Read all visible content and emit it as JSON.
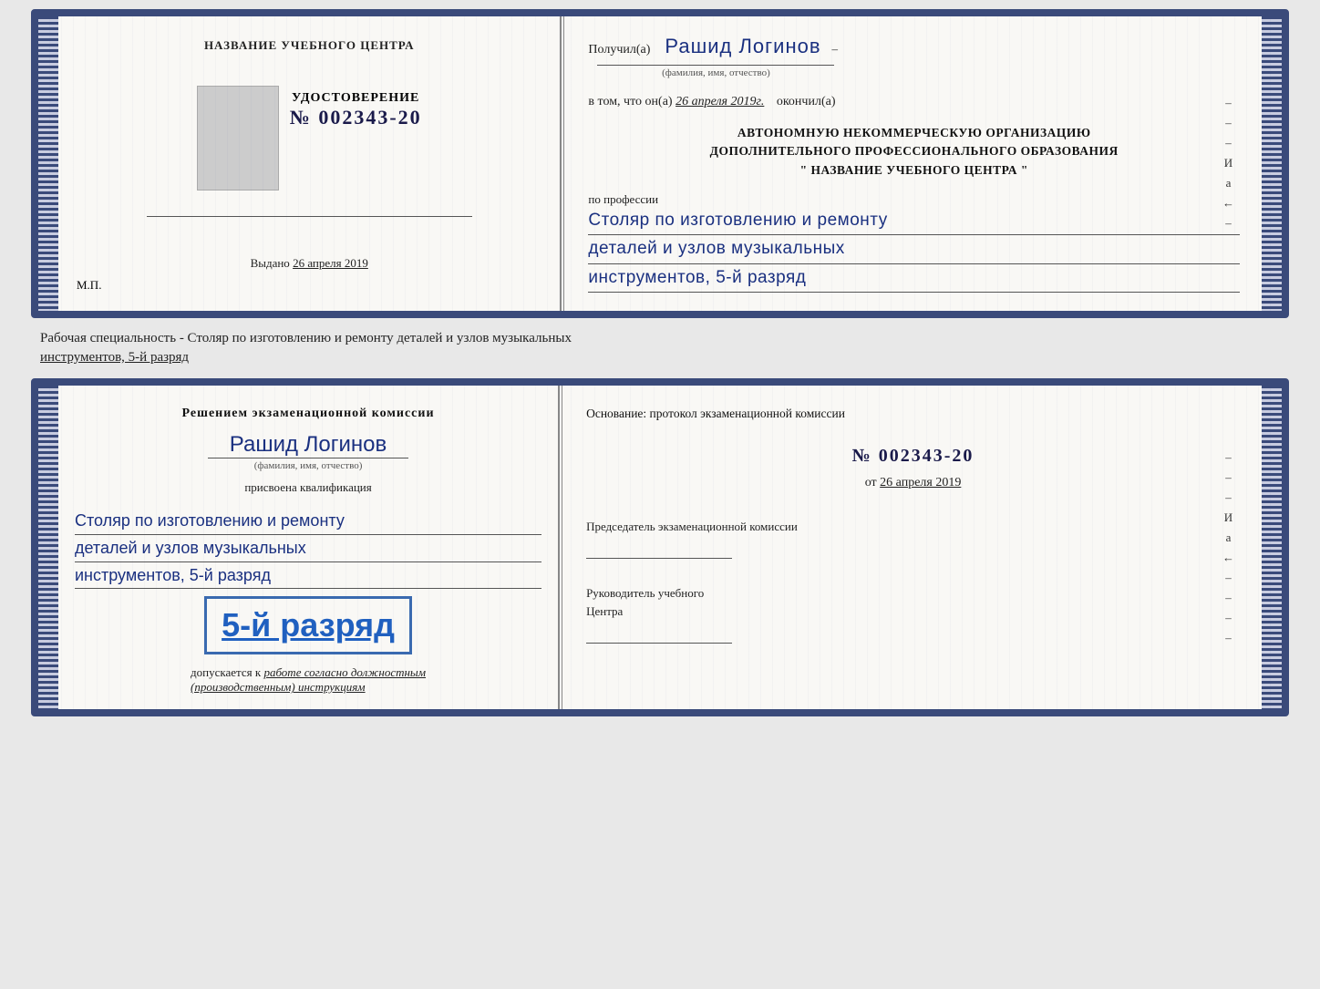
{
  "card1": {
    "left": {
      "title": "НАЗВАНИЕ УЧЕБНОГО ЦЕНТРА",
      "cert_label": "УДОСТОВЕРЕНИЕ",
      "cert_number": "№ 002343-20",
      "issued_label": "Выдано",
      "issued_date": "26 апреля 2019",
      "mp_label": "М.П."
    },
    "right": {
      "received_label": "Получил(а)",
      "received_name": "Рашид Логинов",
      "fio_label": "(фамилия, имя, отчество)",
      "vtom_prefix": "в том, что он(а)",
      "vtom_date": "26 апреля 2019г.",
      "vtom_suffix": "окончил(а)",
      "org_line1": "АВТОНОМНУЮ НЕКОММЕРЧЕСКУЮ ОРГАНИЗАЦИЮ",
      "org_line2": "ДОПОЛНИТЕЛЬНОГО ПРОФЕССИОНАЛЬНОГО ОБРАЗОВАНИЯ",
      "org_line3": "\"  НАЗВАНИЕ УЧЕБНОГО ЦЕНТРА  \"",
      "po_professii": "по профессии",
      "profession_line1": "Столяр по изготовлению и ремонту",
      "profession_line2": "деталей и узлов музыкальных",
      "profession_line3": "инструментов, 5-й разряд",
      "right_marks": [
        "–",
        "–",
        "–",
        "И",
        "а",
        "←",
        "–"
      ]
    }
  },
  "specialty_text": {
    "prefix": "Рабочая специальность - Столяр по изготовлению и ремонту деталей и узлов музыкальных",
    "underlined": "инструментов, 5-й разряд"
  },
  "card2": {
    "left": {
      "decision_label": "Решением  экзаменационной  комиссии",
      "person_name": "Рашид Логинов",
      "fio_label": "(фамилия, имя, отчество)",
      "prisvoena_label": "присвоена квалификация",
      "profession_line1": "Столяр по изготовлению и ремонту",
      "profession_line2": "деталей и узлов музыкальных",
      "profession_line3": "инструментов, 5-й разряд",
      "big_rank": "5-й разряд",
      "dopusk_prefix": "допускается к",
      "dopusk_cursive": "работе согласно должностным",
      "dopusk_cursive2": "(производственным) инструкциям"
    },
    "right": {
      "osnov_label": "Основание: протокол экзаменационной  комиссии",
      "protocol_number": "№  002343-20",
      "ot_prefix": "от",
      "ot_date": "26 апреля 2019",
      "chairman_label": "Председатель экзаменационной комиссии",
      "rukovoditel_label": "Руководитель учебного",
      "tsentra_label": "Центра",
      "right_marks": [
        "–",
        "–",
        "–",
        "И",
        "а",
        "←",
        "–",
        "–",
        "–",
        "–"
      ]
    }
  }
}
